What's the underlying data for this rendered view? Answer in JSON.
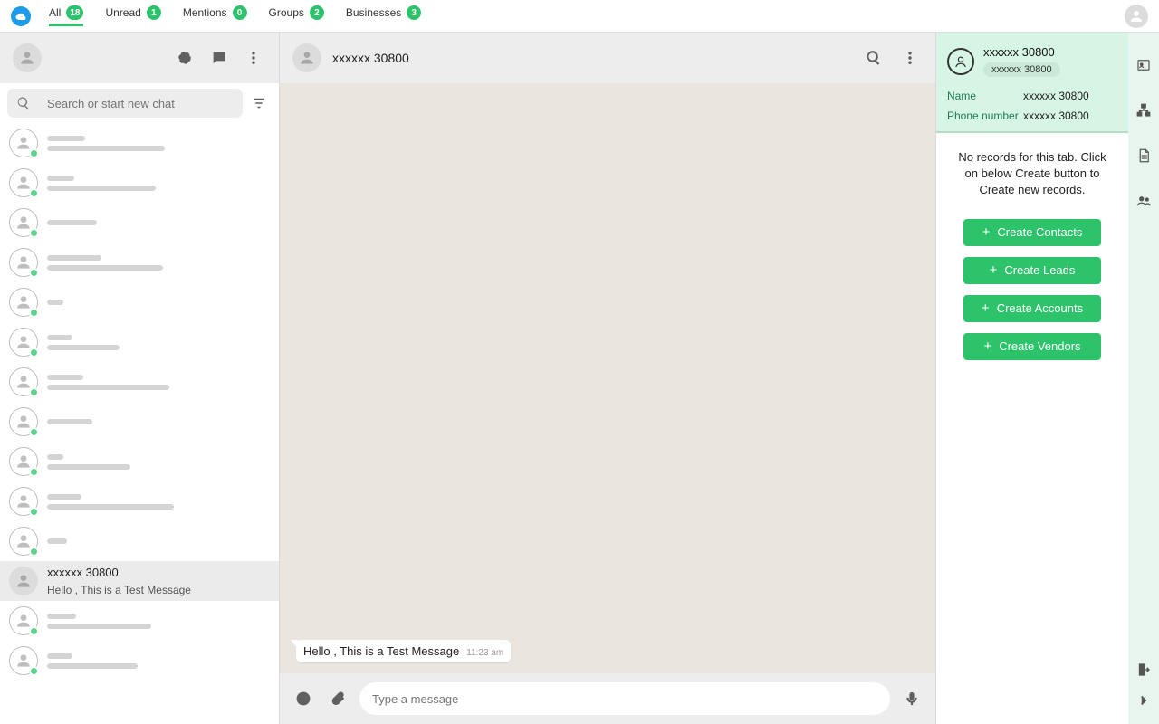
{
  "topbar": {
    "tabs": [
      {
        "label": "All",
        "count": "18",
        "active": true
      },
      {
        "label": "Unread",
        "count": "1",
        "active": false
      },
      {
        "label": "Mentions",
        "count": "0",
        "active": false
      },
      {
        "label": "Groups",
        "count": "2",
        "active": false
      },
      {
        "label": "Businesses",
        "count": "3",
        "active": false
      }
    ]
  },
  "left": {
    "search_placeholder": "Search or start new chat",
    "selected_chat": {
      "title": "xxxxxx 30800",
      "subtitle": "Hello , This is a Test Message"
    }
  },
  "center": {
    "title": "xxxxxx 30800",
    "message": {
      "text": "Hello , This is a Test Message",
      "time": "11:23 am"
    },
    "compose_placeholder": "Type a message"
  },
  "right": {
    "name_header": "xxxxxx 30800",
    "chip": "xxxxxx 30800",
    "fields": {
      "name_label": "Name",
      "name_value": "xxxxxx 30800",
      "phone_label": "Phone number",
      "phone_value": "xxxxxx 30800"
    },
    "no_records": "No records for this tab. Click on below Create button to Create new records.",
    "buttons": {
      "contacts": "Create Contacts",
      "leads": "Create Leads",
      "accounts": "Create Accounts",
      "vendors": "Create Vendors"
    }
  }
}
